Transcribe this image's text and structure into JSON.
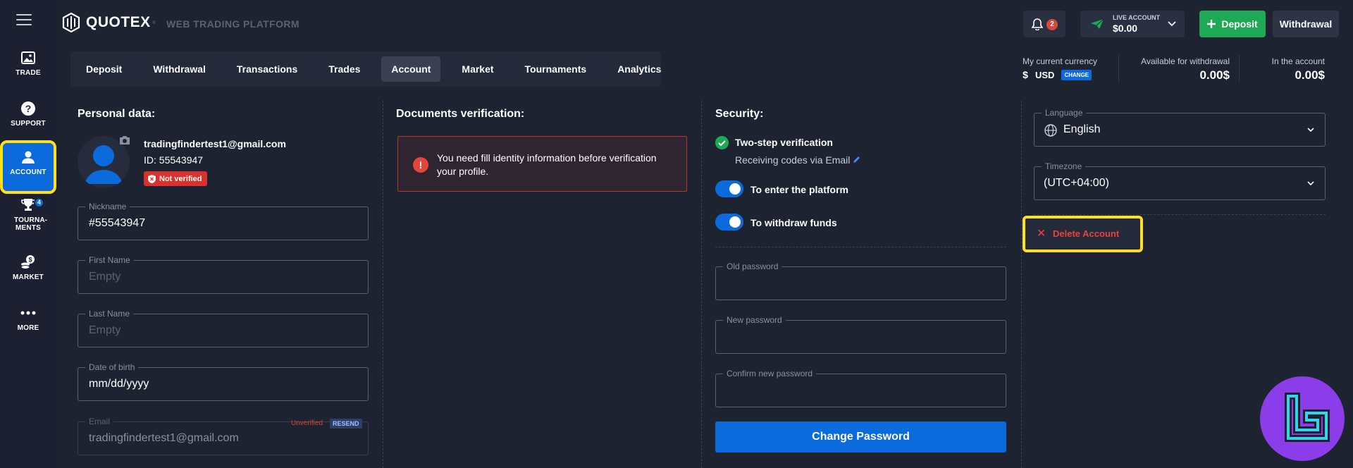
{
  "app": {
    "name": "QUOTEX",
    "subtitle": "WEB TRADING PLATFORM"
  },
  "sidebar": {
    "items": [
      {
        "label": "TRADE",
        "icon": "image-icon"
      },
      {
        "label": "SUPPORT",
        "icon": "help-icon"
      },
      {
        "label": "ACCOUNT",
        "icon": "user-icon"
      },
      {
        "label": "TOURNA-MENTS",
        "icon": "trophy-icon",
        "badge": "4"
      },
      {
        "label": "MARKET",
        "icon": "coins-icon"
      },
      {
        "label": "MORE",
        "icon": "dots-icon"
      }
    ]
  },
  "header": {
    "notifications_count": "2",
    "account_type": "LIVE ACCOUNT",
    "account_balance": "$0.00",
    "deposit_label": "Deposit",
    "withdrawal_label": "Withdrawal"
  },
  "tabs": [
    "Deposit",
    "Withdrawal",
    "Transactions",
    "Trades",
    "Account",
    "Market",
    "Tournaments",
    "Analytics"
  ],
  "active_tab": "Account",
  "currency": {
    "label": "My current currency",
    "symbol": "$",
    "code": "USD",
    "change_label": "CHANGE"
  },
  "balances": {
    "available_label": "Available for withdrawal",
    "available_value": "0.00$",
    "account_label": "In the account",
    "account_value": "0.00$"
  },
  "personal": {
    "title": "Personal data:",
    "email": "tradingfindertest1@gmail.com",
    "id": "ID: 55543947",
    "status": "Not verified",
    "fields": {
      "nickname": {
        "label": "Nickname",
        "value": "#55543947"
      },
      "first_name": {
        "label": "First Name",
        "placeholder": "Empty"
      },
      "last_name": {
        "label": "Last Name",
        "placeholder": "Empty"
      },
      "dob": {
        "label": "Date of birth",
        "value": "mm/dd/yyyy"
      },
      "email": {
        "label": "Email",
        "value": "tradingfindertest1@gmail.com",
        "status": "Unverified",
        "resend": "RESEND"
      }
    }
  },
  "documents": {
    "title": "Documents verification:",
    "alert": "You need fill identity information before verification your profile."
  },
  "security": {
    "title": "Security:",
    "two_step": "Two-step verification",
    "receiving": "Receiving codes via Email",
    "toggle_platform": "To enter the platform",
    "toggle_withdraw": "To withdraw funds",
    "old_password": "Old password",
    "new_password": "New password",
    "confirm_password": "Confirm new password",
    "change_button": "Change Password"
  },
  "settings": {
    "language_label": "Language",
    "language_value": "English",
    "timezone_label": "Timezone",
    "timezone_value": "(UTC+04:00)",
    "delete_label": "Delete Account"
  },
  "colors": {
    "bg": "#1e2332",
    "accent": "#0b6bdc",
    "green": "#1eaa54",
    "danger": "#e3463c",
    "highlight": "#ffe01b"
  }
}
